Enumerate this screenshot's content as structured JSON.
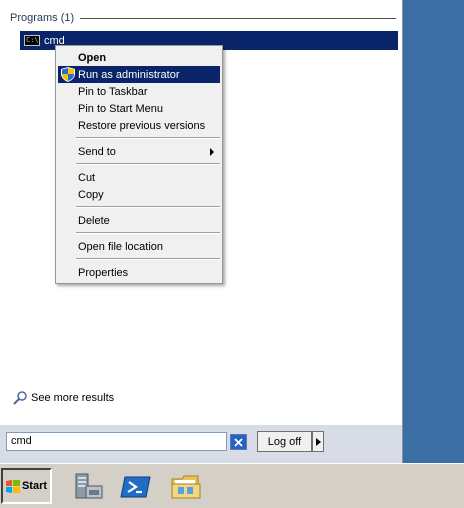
{
  "start_menu": {
    "programs_header": "Programs (1)",
    "result": {
      "icon": "cmd-prompt-icon",
      "label": "cmd"
    },
    "see_more": "See more results",
    "search": {
      "value": "cmd"
    },
    "log_off_label": "Log off"
  },
  "context_menu": {
    "items": [
      {
        "label": "Open"
      },
      {
        "label": "Run as administrator"
      },
      {
        "label": "Pin to Taskbar"
      },
      {
        "label": "Pin to Start Menu"
      },
      {
        "label": "Restore previous versions"
      },
      {
        "label": "Send to"
      },
      {
        "label": "Cut"
      },
      {
        "label": "Copy"
      },
      {
        "label": "Delete"
      },
      {
        "label": "Open file location"
      },
      {
        "label": "Properties"
      }
    ]
  },
  "taskbar": {
    "start_label": "Start",
    "pinned": [
      "server-manager-icon",
      "powershell-icon",
      "explorer-folder-icon"
    ]
  },
  "colors": {
    "desktop": "#3a6ea5",
    "selection": "#0a246a",
    "taskbar": "#d4d0c8"
  }
}
